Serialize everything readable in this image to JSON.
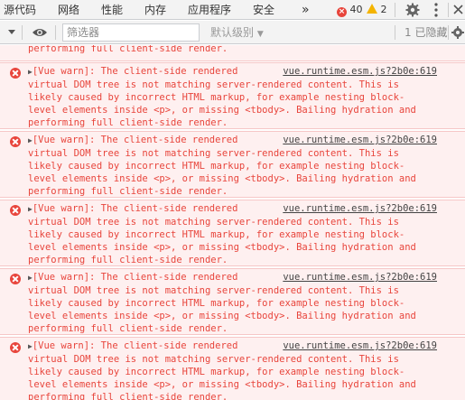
{
  "tabs": [
    {
      "label": "源代码"
    },
    {
      "label": "网络"
    },
    {
      "label": "性能"
    },
    {
      "label": "内存"
    },
    {
      "label": "应用程序"
    },
    {
      "label": "安全"
    }
  ],
  "more_tabs": "»",
  "counts": {
    "errors": "40",
    "warnings": "2"
  },
  "toolbar": {
    "filter_placeholder": "筛选器",
    "level_label": "默认级别",
    "hidden_label": "1 已隐藏"
  },
  "messages": [
    {
      "partial": true,
      "text": "performing full client-side render."
    },
    {
      "lines": [
        "[Vue warn]: The client-side rendered",
        "virtual DOM tree is not matching server-rendered content. This is",
        "likely caused by incorrect HTML markup, for example nesting block-",
        "level elements inside <p>, or missing <tbody>. Bailing hydration and",
        "performing full client-side render."
      ],
      "link": "vue.runtime.esm.js?2b0e:619"
    },
    {
      "lines": [
        "[Vue warn]: The client-side rendered",
        "virtual DOM tree is not matching server-rendered content. This is",
        "likely caused by incorrect HTML markup, for example nesting block-",
        "level elements inside <p>, or missing <tbody>. Bailing hydration and",
        "performing full client-side render."
      ],
      "link": "vue.runtime.esm.js?2b0e:619"
    },
    {
      "lines": [
        "[Vue warn]: The client-side rendered",
        "virtual DOM tree is not matching server-rendered content. This is",
        "likely caused by incorrect HTML markup, for example nesting block-",
        "level elements inside <p>, or missing <tbody>. Bailing hydration and",
        "performing full client-side render."
      ],
      "link": "vue.runtime.esm.js?2b0e:619"
    },
    {
      "lines": [
        "[Vue warn]: The client-side rendered",
        "virtual DOM tree is not matching server-rendered content. This is",
        "likely caused by incorrect HTML markup, for example nesting block-",
        "level elements inside <p>, or missing <tbody>. Bailing hydration and",
        "performing full client-side render."
      ],
      "link": "vue.runtime.esm.js?2b0e:619"
    },
    {
      "lines": [
        "[Vue warn]: The client-side rendered",
        "virtual DOM tree is not matching server-rendered content. This is",
        "likely caused by incorrect HTML markup, for example nesting block-",
        "level elements inside <p>, or missing <tbody>. Bailing hydration and",
        "performing full client-side render."
      ],
      "link": "vue.runtime.esm.js?2b0e:619"
    }
  ],
  "colors": {
    "error": "#e8453c",
    "warning": "#f4b400",
    "error_bg": "#fef0f0"
  }
}
